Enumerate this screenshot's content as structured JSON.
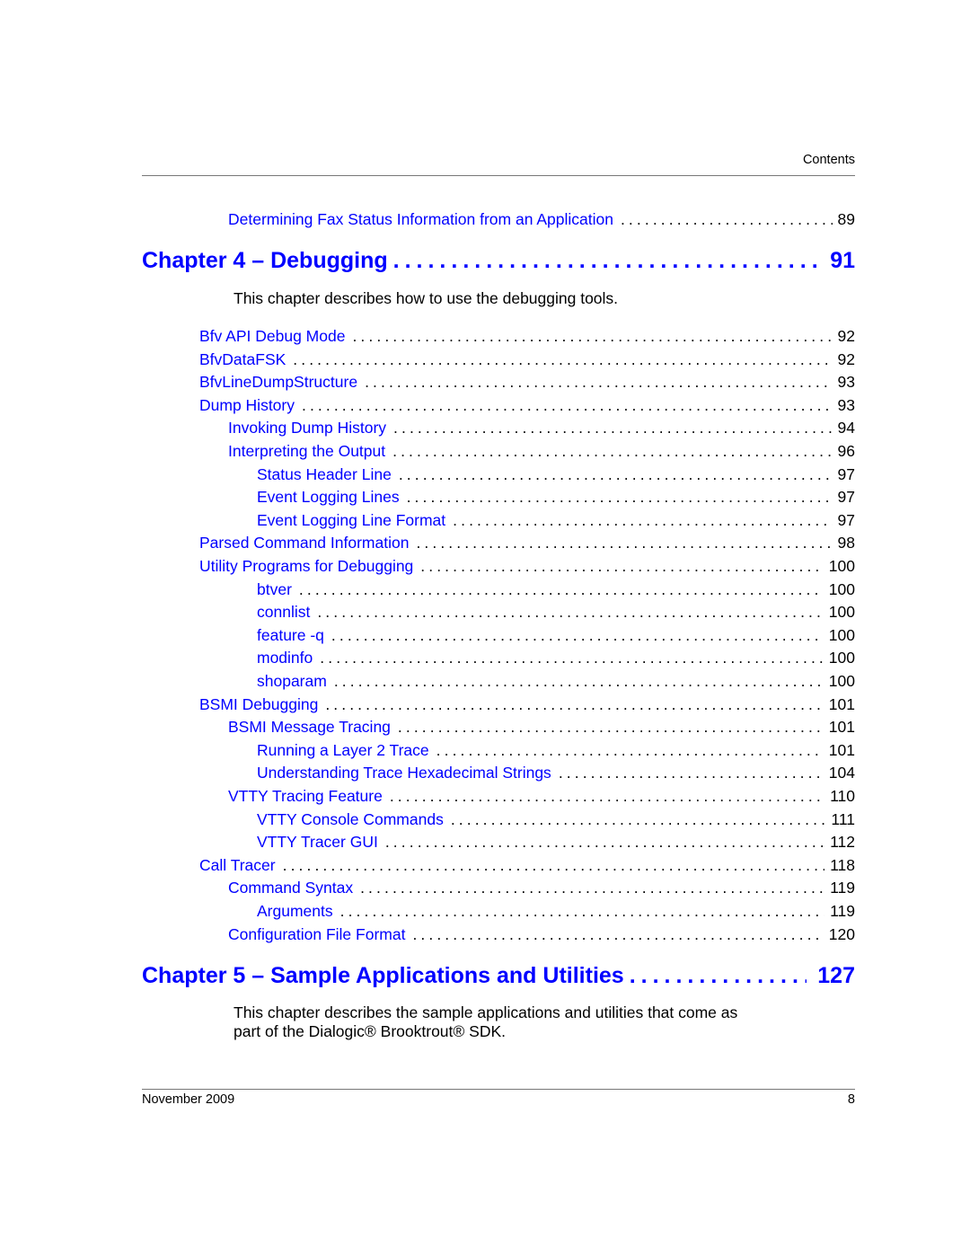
{
  "header": {
    "section": "Contents"
  },
  "pre_entry": {
    "title": "Determining Fax Status Information from an Application",
    "page": "89"
  },
  "chapter4": {
    "title": "Chapter 4 – Debugging",
    "page": "91",
    "description": "This chapter describes how to use the debugging tools."
  },
  "entries": [
    {
      "title": "Bfv API Debug Mode",
      "page": "92",
      "level": 1
    },
    {
      "title": "BfvDataFSK",
      "page": "92",
      "level": 1
    },
    {
      "title": "BfvLineDumpStructure",
      "page": "93",
      "level": 1
    },
    {
      "title": "Dump History",
      "page": "93",
      "level": 1
    },
    {
      "title": "Invoking Dump History",
      "page": "94",
      "level": 2
    },
    {
      "title": "Interpreting the Output",
      "page": "96",
      "level": 2
    },
    {
      "title": "Status Header Line",
      "page": "97",
      "level": 3
    },
    {
      "title": "Event Logging Lines",
      "page": "97",
      "level": 3
    },
    {
      "title": "Event Logging Line Format",
      "page": "97",
      "level": 3
    },
    {
      "title": "Parsed Command Information",
      "page": "98",
      "level": 1
    },
    {
      "title": "Utility Programs for Debugging",
      "page": "100",
      "level": 1
    },
    {
      "title": "btver",
      "page": "100",
      "level": 3
    },
    {
      "title": "connlist",
      "page": "100",
      "level": 3
    },
    {
      "title": "feature -q",
      "page": "100",
      "level": 3
    },
    {
      "title": "modinfo",
      "page": "100",
      "level": 3
    },
    {
      "title": "shoparam",
      "page": "100",
      "level": 3
    },
    {
      "title": "BSMI Debugging",
      "page": "101",
      "level": 1
    },
    {
      "title": "BSMI Message Tracing",
      "page": "101",
      "level": 2
    },
    {
      "title": "Running a Layer 2 Trace",
      "page": "101",
      "level": 3
    },
    {
      "title": "Understanding Trace Hexadecimal Strings",
      "page": "104",
      "level": 3
    },
    {
      "title": "VTTY Tracing Feature",
      "page": "110",
      "level": 2
    },
    {
      "title": "VTTY Console Commands",
      "page": "111",
      "level": 3
    },
    {
      "title": "VTTY Tracer GUI",
      "page": "112",
      "level": 3
    },
    {
      "title": "Call Tracer",
      "page": "118",
      "level": 1
    },
    {
      "title": "Command Syntax",
      "page": "119",
      "level": 2
    },
    {
      "title": "Arguments",
      "page": "119",
      "level": 3
    },
    {
      "title": "Configuration File Format",
      "page": "120",
      "level": 2
    }
  ],
  "chapter5": {
    "title": "Chapter 5 – Sample Applications and Utilities",
    "page": "127",
    "description_line1": "This chapter describes the sample applications and utilities that come as",
    "description_line2": "part of the Dialogic® Brooktrout® SDK."
  },
  "footer": {
    "date": "November 2009",
    "page": "8"
  },
  "colors": {
    "link": "#0000ff",
    "text": "#000000",
    "rule": "#777777"
  }
}
